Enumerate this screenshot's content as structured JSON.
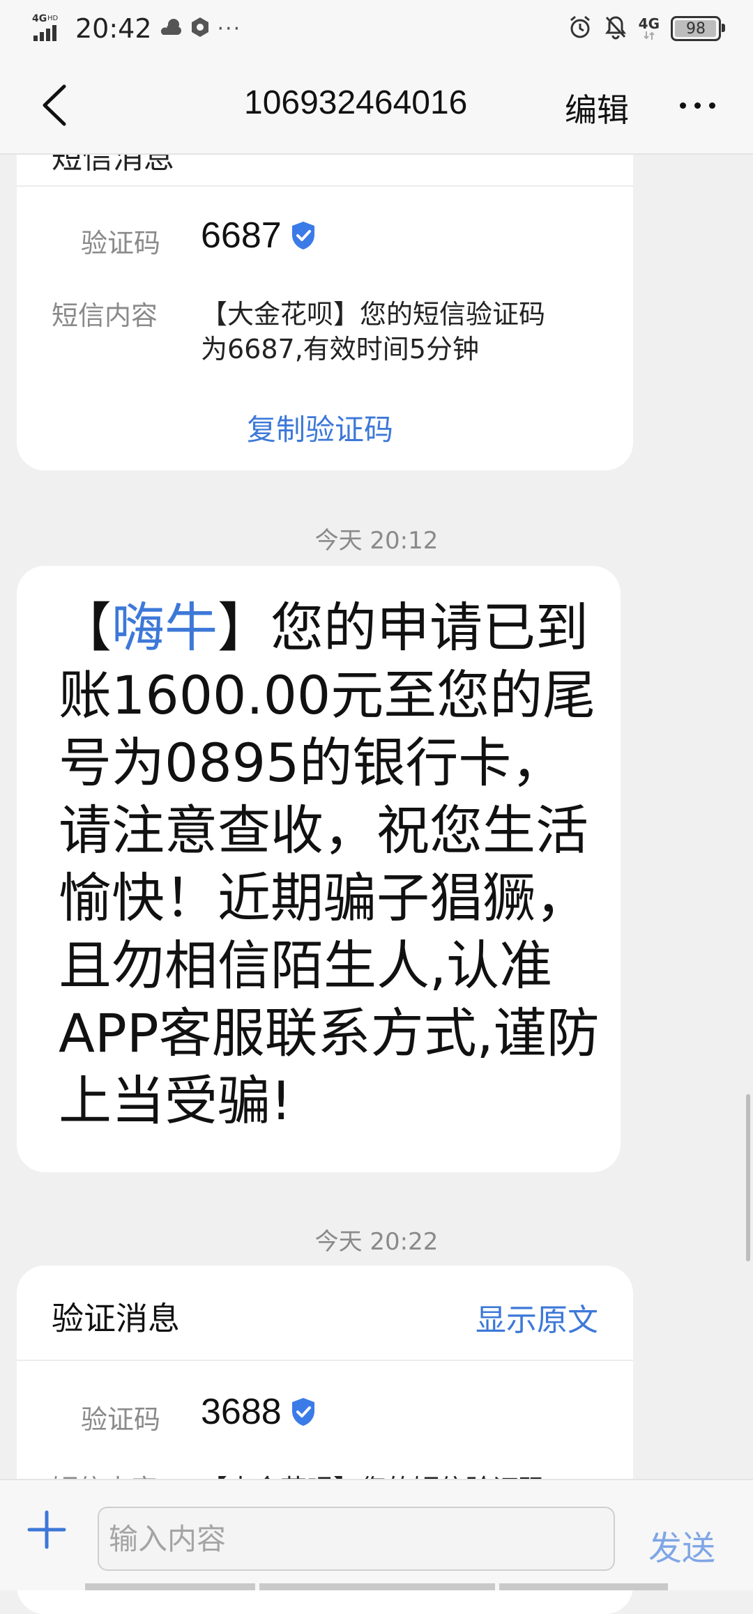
{
  "status_bar": {
    "network_label": "4G HD",
    "time": "20:42",
    "more": "···",
    "right_network": "4G",
    "battery": "98"
  },
  "header": {
    "title": "106932464016",
    "edit": "编辑"
  },
  "card_top": {
    "header_partial": "短信消息",
    "code_label": "验证码",
    "code": "6687",
    "content_label": "短信内容",
    "content_line1": "【大金花呗】您的短信验证码",
    "content_line2": "为6687,有效时间5分钟",
    "copy_button": "复制验证码"
  },
  "timestamp1": "今天 20:12",
  "message": {
    "bracket_open": "【",
    "brand": "嗨牛",
    "bracket_close": "】",
    "line1_rest": "您的申请已到",
    "line2": "账1600.00元至您的尾",
    "line3": "号为0895的银行卡，",
    "line4": "请注意查收，祝您生活",
    "line5": "愉快！近期骗子猖獗，",
    "line6": "且勿相信陌生人,认准",
    "line7": "APP客服联系方式,谨防",
    "line8": "上当受骗!"
  },
  "timestamp2": "今天 20:22",
  "card_bottom": {
    "title": "验证消息",
    "show_original": "显示原文",
    "code_label": "验证码",
    "code": "3688",
    "content_label_partial": "短信内容",
    "content_partial": "【大金花呗】您的短信验证码"
  },
  "composer": {
    "placeholder": "输入内容",
    "send": "发送"
  },
  "colors": {
    "accent": "#3d78d8",
    "verified": "#3b7be8",
    "send_disabled": "#7fa6e6"
  }
}
